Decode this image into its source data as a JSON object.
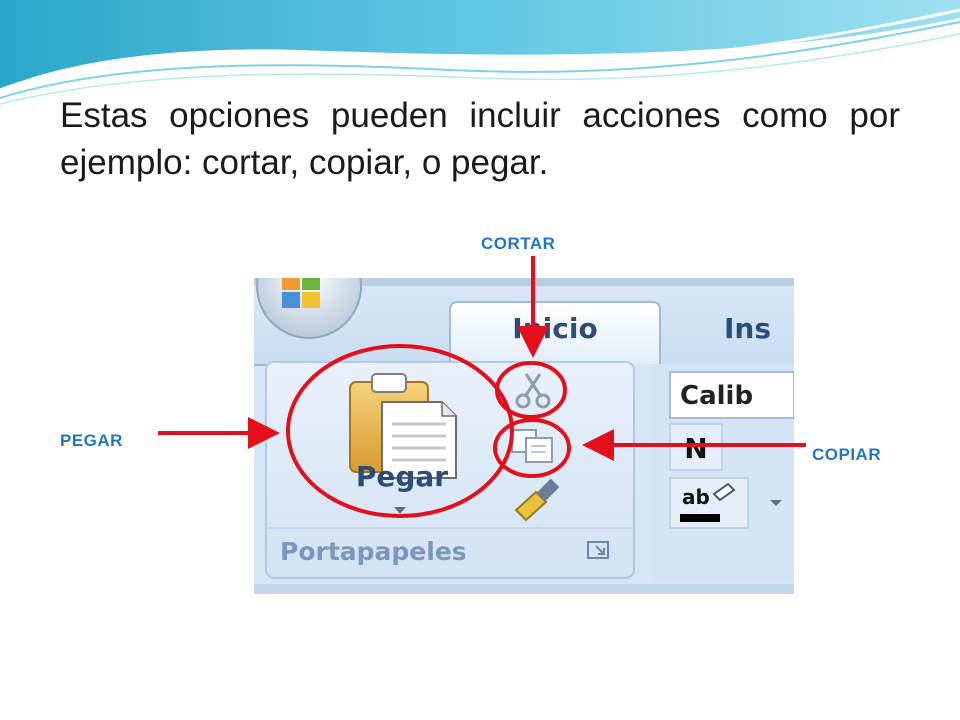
{
  "slide": {
    "body_text": "Estas opciones pueden incluir acciones como por ejemplo: cortar, copiar, o pegar."
  },
  "callouts": {
    "cortar": "CORTAR",
    "pegar": "PEGAR",
    "copiar": "COPIAR"
  },
  "ribbon": {
    "tab_home": "Inicio",
    "tab_insert": "Ins",
    "paste_label": "Pegar",
    "group_label": "Portapapeles",
    "font_name": "Calib",
    "bold_glyph": "N",
    "highlight_glyph": "ab"
  },
  "colors": {
    "callout_text": "#2275c4",
    "annotation_red": "#e3101b",
    "ribbon_bg": "#d3e3f5"
  }
}
